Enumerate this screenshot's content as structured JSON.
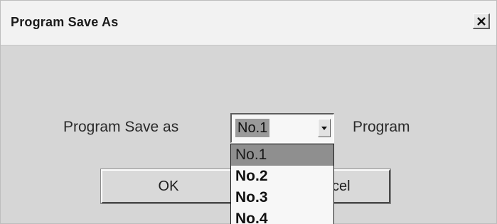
{
  "window": {
    "title": "Program Save As",
    "close_glyph": "×"
  },
  "form": {
    "prompt_label": "Program Save as",
    "suffix_label": "Program",
    "selected_value": "No.1"
  },
  "dropdown": {
    "items": [
      "No.1",
      "No.2",
      "No.3",
      "No.4"
    ]
  },
  "buttons": {
    "ok_label": "OK",
    "cancel_label_visible": "cel"
  },
  "icons": {
    "close": "close-icon",
    "dropdown_arrow": "chevron-down-icon"
  }
}
